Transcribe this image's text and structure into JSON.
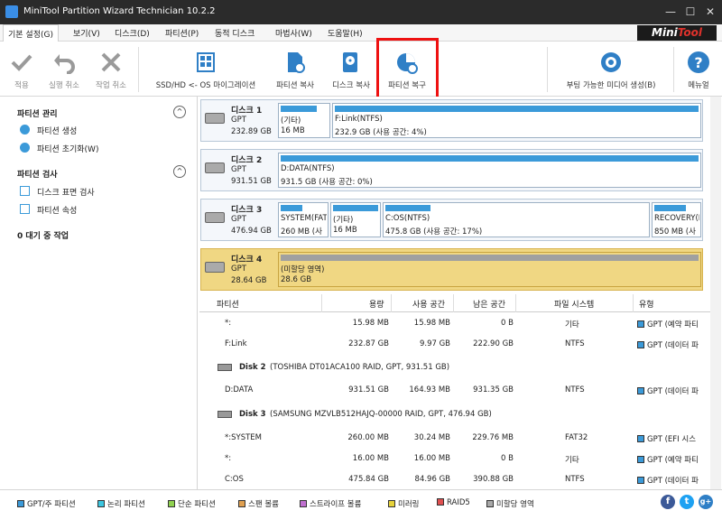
{
  "window": {
    "title": "MiniTool Partition Wizard Technician 10.2.2",
    "minimize": "—",
    "maximize": "☐",
    "close": "✕"
  },
  "menu": [
    "기본 설정(G)",
    "보기(V)",
    "디스크(D)",
    "파티션(P)",
    "동적 디스크",
    "마법사(W)",
    "도움말(H)"
  ],
  "brand": {
    "a": "Mini",
    "b": "Tool"
  },
  "toolbar": {
    "apply": "적용",
    "undo": "실행 취소",
    "discard": "작업 취소",
    "migrate": "SSD/HD <- OS 마이그레이션",
    "copy_partition": "파티션 복사",
    "copy_disk": "디스크 복사",
    "recover_partition": "파티션 복구",
    "bootable_media": "부팅 가능한 미디어 생성(B)",
    "manual": "메뉴얼"
  },
  "sidebar": {
    "group1": "파티션 관리",
    "create": "파티션 생성",
    "initialize": "파티션 초기화(W)",
    "group2": "파티션 검사",
    "surface": "디스크 표면 검사",
    "properties": "파티션 속성",
    "pending": "0 대기 중 작업"
  },
  "disks": [
    {
      "name": "디스크 1",
      "type": "GPT",
      "size": "232.89 GB",
      "parts": [
        {
          "label": "(기타)",
          "size": "16 MB"
        },
        {
          "label": "F:Link(NTFS)",
          "size": "232.9 GB (사용 공간: 4%)"
        }
      ]
    },
    {
      "name": "디스크 2",
      "type": "GPT",
      "size": "931.51 GB",
      "parts": [
        {
          "label": "D:DATA(NTFS)",
          "size": "931.5 GB (사용 공간: 0%)"
        }
      ]
    },
    {
      "name": "디스크 3",
      "type": "GPT",
      "size": "476.94 GB",
      "parts": [
        {
          "label": "SYSTEM(FAT",
          "size": "260 MB (사"
        },
        {
          "label": "(기타)",
          "size": "16 MB"
        },
        {
          "label": "C:OS(NTFS)",
          "size": "475.8 GB (사용 공간: 17%)"
        },
        {
          "label": "RECOVERY(N",
          "size": "850 MB (사"
        }
      ]
    },
    {
      "name": "디스크 4",
      "type": "GPT",
      "size": "28.64 GB",
      "parts": [
        {
          "label": "(미할당 영역)",
          "size": "28.6 GB"
        }
      ]
    }
  ],
  "table": {
    "headers": [
      "파티션",
      "용량",
      "사용 공간",
      "남은 공간",
      "파일 시스템",
      "유형"
    ],
    "rows1": [
      [
        "*:",
        "15.98 MB",
        "15.98 MB",
        "0 B",
        "기타",
        "GPT (예약 파티"
      ],
      [
        "F:Link",
        "232.87 GB",
        "9.97 GB",
        "222.90 GB",
        "NTFS",
        "GPT (데이터 파"
      ]
    ],
    "disk2": {
      "name": "Disk 2",
      "detail": "(TOSHIBA DT01ACA100 RAID, GPT, 931.51 GB)"
    },
    "rows2": [
      [
        "D:DATA",
        "931.51 GB",
        "164.93 MB",
        "931.35 GB",
        "NTFS",
        "GPT (데이터 파"
      ]
    ],
    "disk3": {
      "name": "Disk 3",
      "detail": "(SAMSUNG MZVLB512HAJQ-00000 RAID, GPT, 476.94 GB)"
    },
    "rows3": [
      [
        "*:SYSTEM",
        "260.00 MB",
        "30.24 MB",
        "229.76 MB",
        "FAT32",
        "GPT (EFI 시스"
      ],
      [
        "*:",
        "16.00 MB",
        "16.00 MB",
        "0 B",
        "기타",
        "GPT (예약 파티"
      ],
      [
        "C:OS",
        "475.84 GB",
        "84.96 GB",
        "390.88 GB",
        "NTFS",
        "GPT (데이터 파"
      ]
    ]
  },
  "legend": [
    {
      "label": "GPT/주 파티션",
      "color": "#3b9ad9"
    },
    {
      "label": "논리 파티션",
      "color": "#3cc6e0"
    },
    {
      "label": "단순 파티션",
      "color": "#8fd14f"
    },
    {
      "label": "스팬 볼륨",
      "color": "#e0a050"
    },
    {
      "label": "스트라이프 볼륨",
      "color": "#c070d0"
    },
    {
      "label": "미러링",
      "color": "#e6d23a"
    },
    {
      "label": "RAID5",
      "color": "#e05050"
    },
    {
      "label": "미할당 영역",
      "color": "#a8a8a8"
    }
  ],
  "social": {
    "fb": "f",
    "tw": "t",
    "gp": "g+"
  },
  "colors": {
    "accent": "#3b9ad9",
    "titlebar": "#2b2b2b",
    "highlight": "#e11111",
    "selected_disk": "#f0d783"
  }
}
